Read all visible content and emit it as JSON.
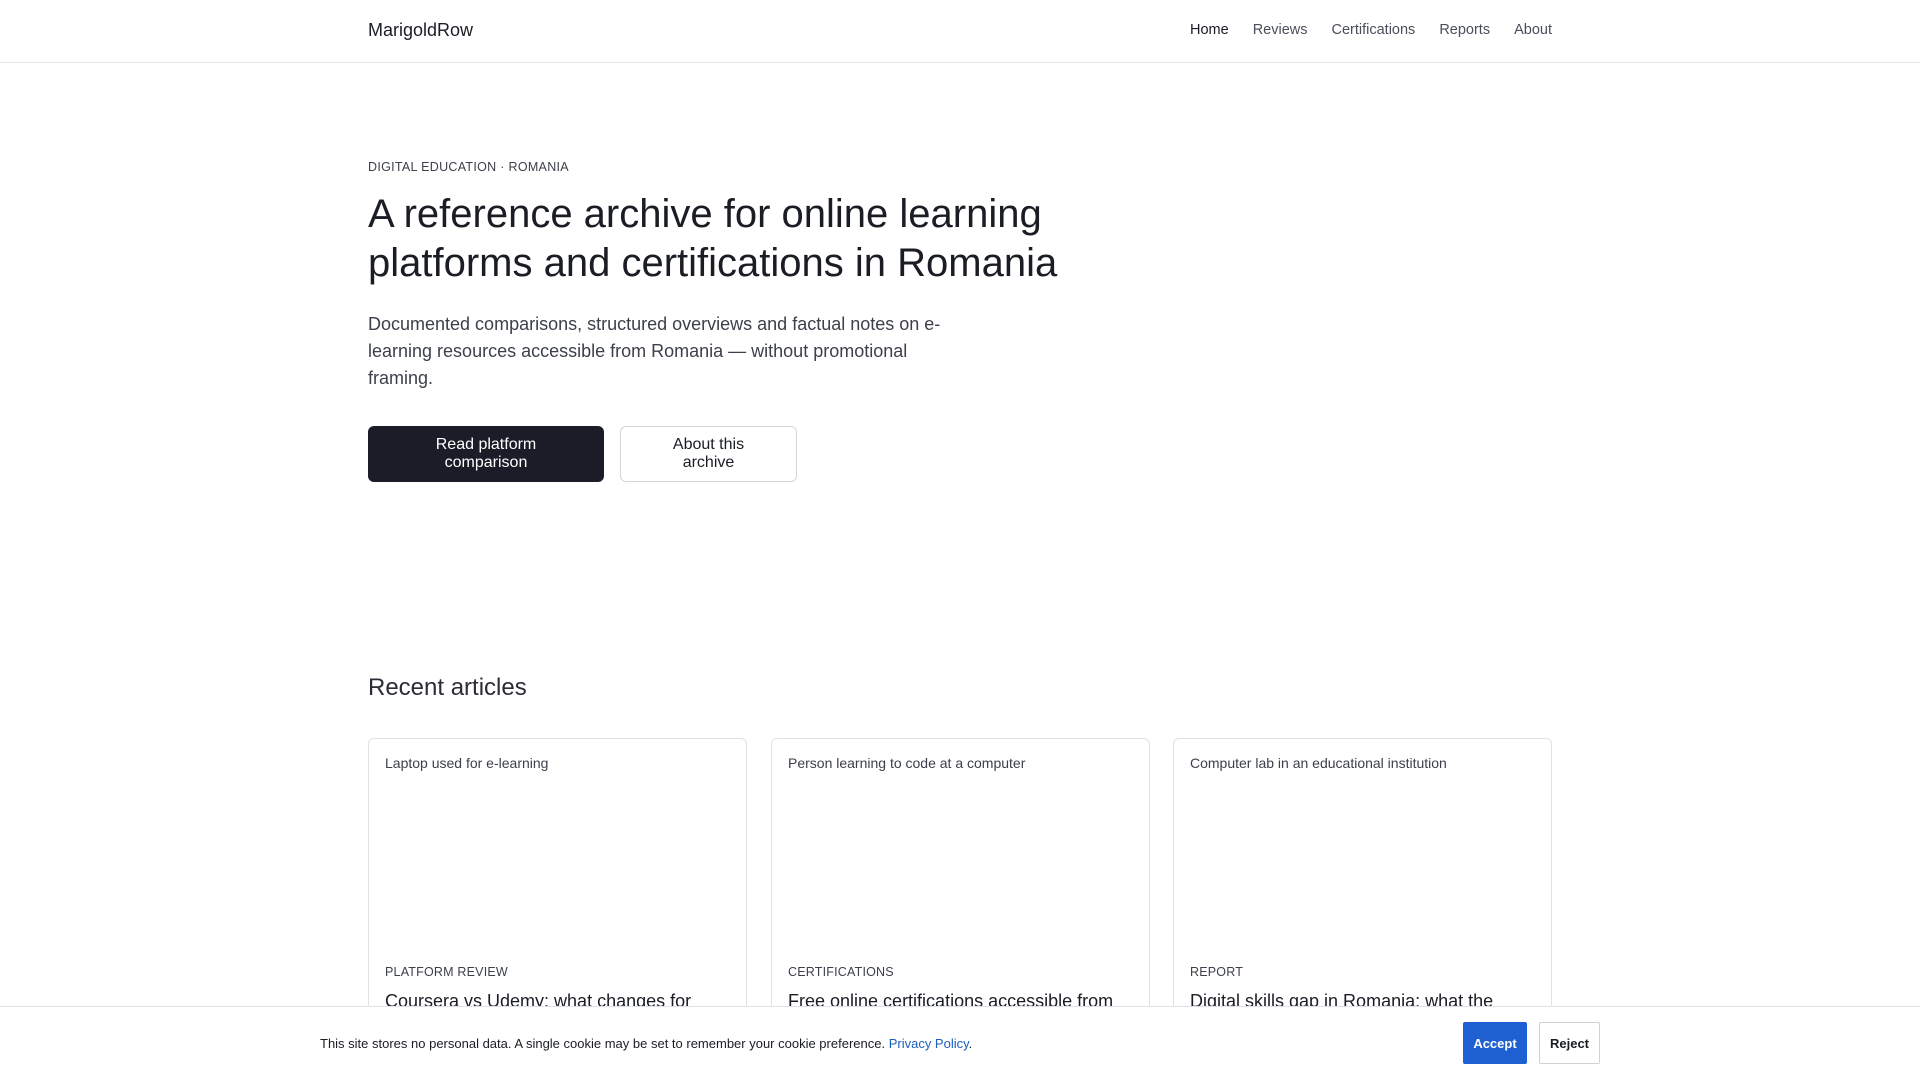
{
  "header": {
    "brand": "MarigoldRow",
    "nav": [
      {
        "label": "Home",
        "active": true
      },
      {
        "label": "Reviews",
        "active": false
      },
      {
        "label": "Certifications",
        "active": false
      },
      {
        "label": "Reports",
        "active": false
      },
      {
        "label": "About",
        "active": false
      }
    ]
  },
  "hero": {
    "eyebrow": "DIGITAL EDUCATION · ROMANIA",
    "title": "A reference archive for online learning platforms and certifications in Romania",
    "lead": "Documented comparisons, structured overviews and factual notes on e-learning resources accessible from Romania — without promotional framing.",
    "primary_button": "Read platform comparison",
    "secondary_button": "About this archive"
  },
  "recent": {
    "title": "Recent articles",
    "cards": [
      {
        "image_alt": "Laptop used for e-learning",
        "tag": "PLATFORM REVIEW",
        "title": "Coursera vs Udemy: what changes for"
      },
      {
        "image_alt": "Person learning to code at a computer",
        "tag": "CERTIFICATIONS",
        "title": "Free online certifications accessible from"
      },
      {
        "image_alt": "Computer lab in an educational institution",
        "tag": "REPORT",
        "title": "Digital skills gap in Romania: what the"
      }
    ]
  },
  "cookie": {
    "text": "This site stores no personal data. A single cookie may be set to remember your cookie preference.",
    "link": "Privacy Policy",
    "period": ".",
    "accept": "Accept",
    "reject": "Reject"
  },
  "colors": {
    "primary_button": "#1a1d27",
    "accept_button": "#1e5fd1",
    "link": "#1b5fbf"
  }
}
